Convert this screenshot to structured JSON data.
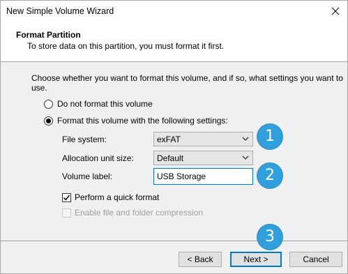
{
  "window": {
    "title": "New Simple Volume Wizard"
  },
  "header": {
    "title": "Format Partition",
    "subtitle": "To store data on this partition, you must format it first."
  },
  "content": {
    "instruction": "Choose whether you want to format this volume, and if so, what settings you want to use.",
    "radio_no_format": {
      "label": "Do not format this volume",
      "checked": false
    },
    "radio_format": {
      "label": "Format this volume with the following settings:",
      "checked": true
    },
    "file_system": {
      "label": "File system:",
      "value": "exFAT"
    },
    "allocation_unit": {
      "label": "Allocation unit size:",
      "value": "Default"
    },
    "volume_label": {
      "label": "Volume label:",
      "value": "USB Storage"
    },
    "quick_format": {
      "label": "Perform a quick format",
      "checked": true
    },
    "compression": {
      "label": "Enable file and folder compression",
      "checked": false,
      "disabled": true
    }
  },
  "buttons": {
    "back": "< Back",
    "next": "Next >",
    "cancel": "Cancel"
  },
  "annotations": {
    "step1": "1",
    "step2": "2",
    "step3": "3",
    "color": "#30a0dd"
  },
  "icons": [
    "close-icon",
    "chevron-down-icon",
    "checkmark-icon"
  ]
}
